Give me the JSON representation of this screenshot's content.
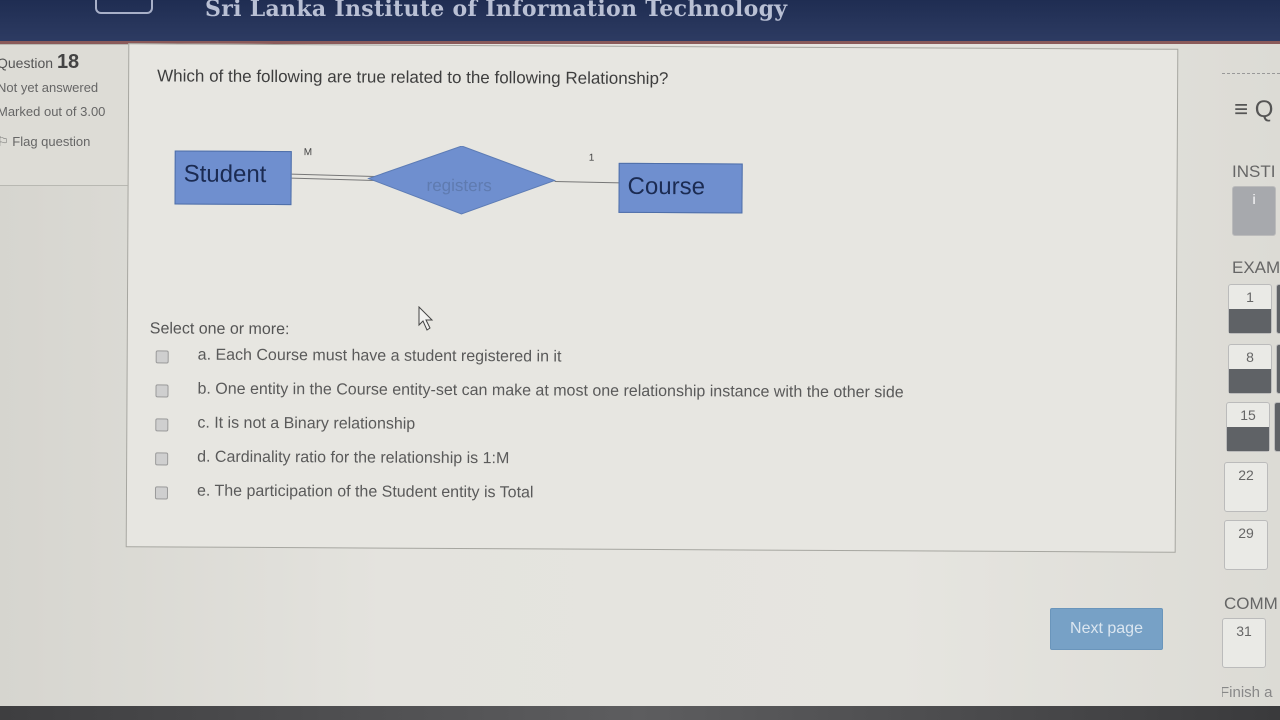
{
  "header": {
    "site_title": "Sri Lanka Institute of Information Technology"
  },
  "question_info": {
    "label": "Question",
    "number": "18",
    "state": "Not yet answered",
    "grade": "Marked out of 3.00",
    "flag_label": "Flag question"
  },
  "question": {
    "text": "Which of the following are true related to the following Relationship?",
    "diagram": {
      "entity_left": "Student",
      "entity_right": "Course",
      "relationship": "registers",
      "cardinality_left": "M",
      "cardinality_right": "1"
    },
    "select_label": "Select one or more:",
    "options": [
      {
        "label": "a. Each Course must have a student registered in it",
        "checked": false
      },
      {
        "label": "b. One entity in the Course entity-set can make at most one relationship instance with the other side",
        "checked": false
      },
      {
        "label": "c. It is not a Binary relationship",
        "checked": false
      },
      {
        "label": "d. Cardinality ratio for the relationship is 1:M",
        "checked": false
      },
      {
        "label": "e. The participation of the Student entity is Total",
        "checked": false
      }
    ]
  },
  "next_button": "Next page",
  "nav": {
    "menu_label": "Q",
    "sections": [
      "INSTI",
      "EXAM",
      "COMM"
    ],
    "instr_button": "i",
    "question_buttons": [
      "1",
      "8",
      "15",
      "22",
      "29",
      "31"
    ],
    "finish_label": "Finish a"
  },
  "colors": {
    "header": "#1f2d52",
    "entity_fill": "#6f8fcf",
    "next_button": "#77a1c6"
  }
}
